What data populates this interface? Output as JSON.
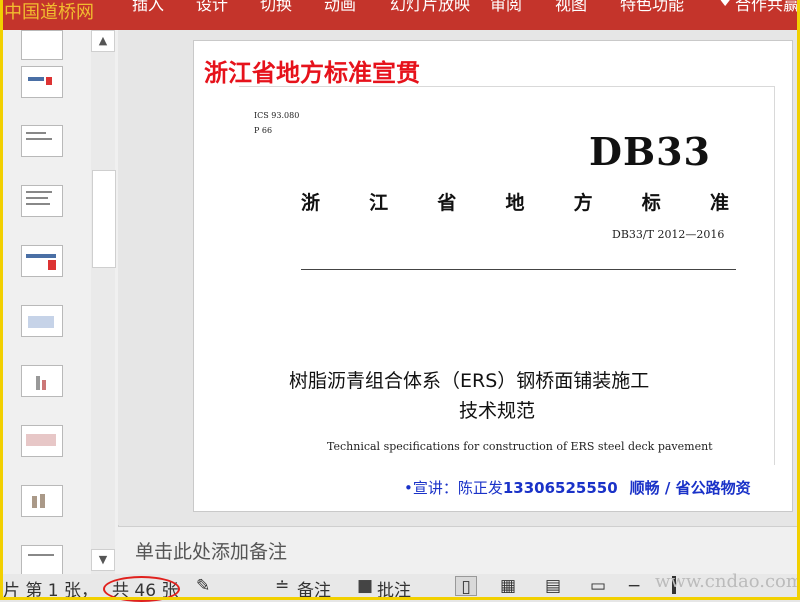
{
  "ribbon": {
    "watermark": "中国道桥网",
    "tabs": [
      "插入",
      "设计",
      "切换",
      "动画",
      "幻灯片放映",
      "审阅",
      "视图",
      "特色功能"
    ],
    "login": "合作共赢"
  },
  "thumbnails": {
    "count_visible": 10
  },
  "slide": {
    "banner_title": "浙江省地方标准宣贯",
    "ics": "ICS 93.080",
    "p_code": "P 66",
    "db_code": "DB33",
    "standard_chars": [
      "浙",
      "江",
      "省",
      "地",
      "方",
      "标",
      "准"
    ],
    "standard_number": "DB33/T 2012—2016",
    "title_cn_line1": "树脂沥青组合体系（ERS）钢桥面铺装施工",
    "title_cn_line2": "技术规范",
    "title_en": "Technical specifications for construction of ERS steel deck pavement",
    "speaker_prefix": "•宣讲：陈正发",
    "speaker_phone": "13306525550",
    "speaker_org": "顺畅 / 省公路物资"
  },
  "notes": {
    "placeholder": "单击此处添加备注"
  },
  "status": {
    "slide_label": "片 第 1 张，",
    "total_label": "共 46 张",
    "notes_btn": "备注",
    "comments_btn": "批注",
    "site_watermark": "www.cndao.com"
  },
  "colors": {
    "ribbon": "#c4342b",
    "banner_title": "#e6121b",
    "speaker": "#1a32c8",
    "frame": "#f2d000",
    "circle": "#e0211d"
  }
}
